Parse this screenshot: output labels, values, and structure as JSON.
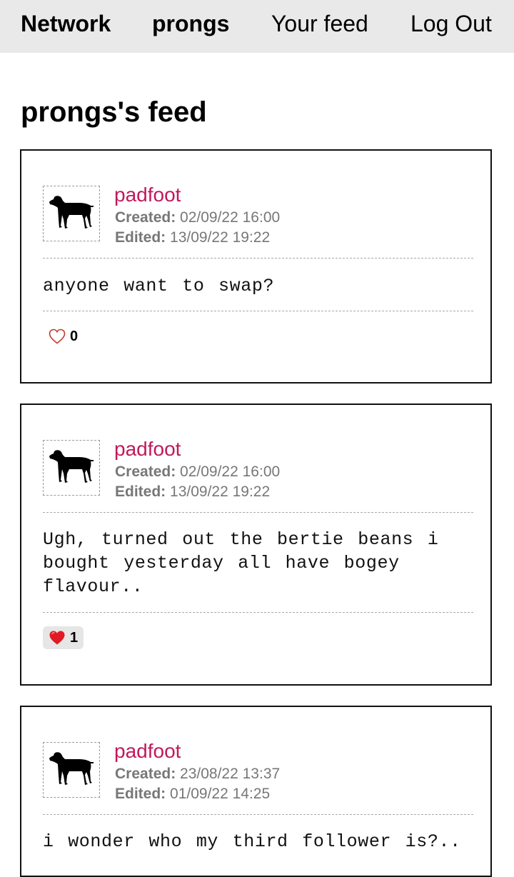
{
  "nav": {
    "brand": "Network",
    "user": "prongs",
    "feed": "Your feed",
    "logout": "Log Out"
  },
  "page": {
    "heading": "prongs's feed"
  },
  "labels": {
    "created": "Created:",
    "edited": "Edited:"
  },
  "icons": {
    "avatar": "dog-icon",
    "like_empty": "heart-outline-icon",
    "like_filled": "heart-filled-icon"
  },
  "colors": {
    "author": "#c2185b",
    "nav_bg": "#e9e9e9",
    "heart_filled": "#e01b24",
    "heart_outline": "#c0392b"
  },
  "posts": [
    {
      "author": "padfoot",
      "created": "02/09/22 16:00",
      "edited": "13/09/22 19:22",
      "content": "anyone want to swap?",
      "likes": "0",
      "liked": false
    },
    {
      "author": "padfoot",
      "created": "02/09/22 16:00",
      "edited": "13/09/22 19:22",
      "content": "Ugh, turned out the bertie beans i bought yesterday all have bogey flavour..",
      "likes": "1",
      "liked": true
    },
    {
      "author": "padfoot",
      "created": "23/08/22 13:37",
      "edited": "01/09/22 14:25",
      "content": "i wonder who my third follower is?..",
      "likes": "",
      "liked": false
    }
  ]
}
